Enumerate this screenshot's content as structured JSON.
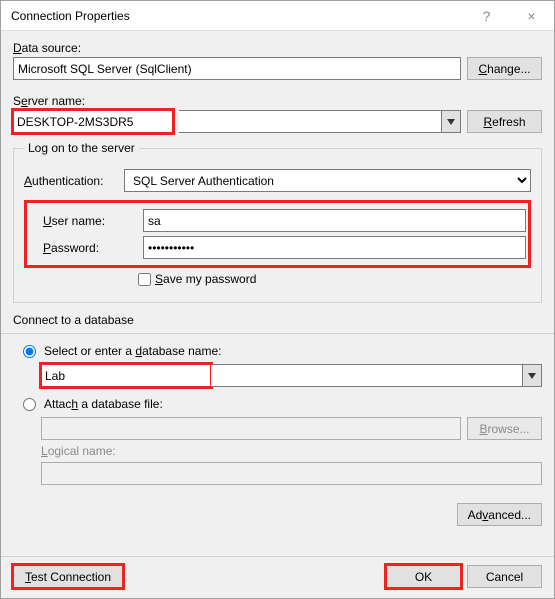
{
  "window": {
    "title": "Connection Properties",
    "help_icon": "?",
    "close_icon": "×"
  },
  "data_source": {
    "label": "Data source:",
    "label_u": "D",
    "value": "Microsoft SQL Server (SqlClient)",
    "change_btn": "Change...",
    "change_u": "C"
  },
  "server": {
    "label": "Server name:",
    "label_u": "e",
    "value": "DESKTOP-2MS3DR5",
    "refresh_btn": "Refresh",
    "refresh_u": "R"
  },
  "logon": {
    "legend": "Log on to the server",
    "auth_label": "Authentication:",
    "auth_u": "A",
    "auth_value": "SQL Server Authentication",
    "user_label": "User name:",
    "user_u": "U",
    "user_value": "sa",
    "pwd_label": "Password:",
    "pwd_u": "P",
    "pwd_value": "•••••••••••",
    "save_pwd": "Save my password",
    "save_pwd_u": "S"
  },
  "db": {
    "legend": "Connect to a database",
    "opt_select": "Select or enter a database name:",
    "opt_select_u": "d",
    "db_value": "Lab",
    "opt_attach": "Attach a database file:",
    "opt_attach_u": "h",
    "attach_path": "",
    "browse_btn": "Browse...",
    "browse_u": "B",
    "logical_label": "Logical name:",
    "logical_u": "L",
    "logical_value": ""
  },
  "buttons": {
    "advanced": "Advanced...",
    "advanced_u": "v",
    "test": "Test Connection",
    "test_u": "T",
    "ok": "OK",
    "cancel": "Cancel"
  }
}
